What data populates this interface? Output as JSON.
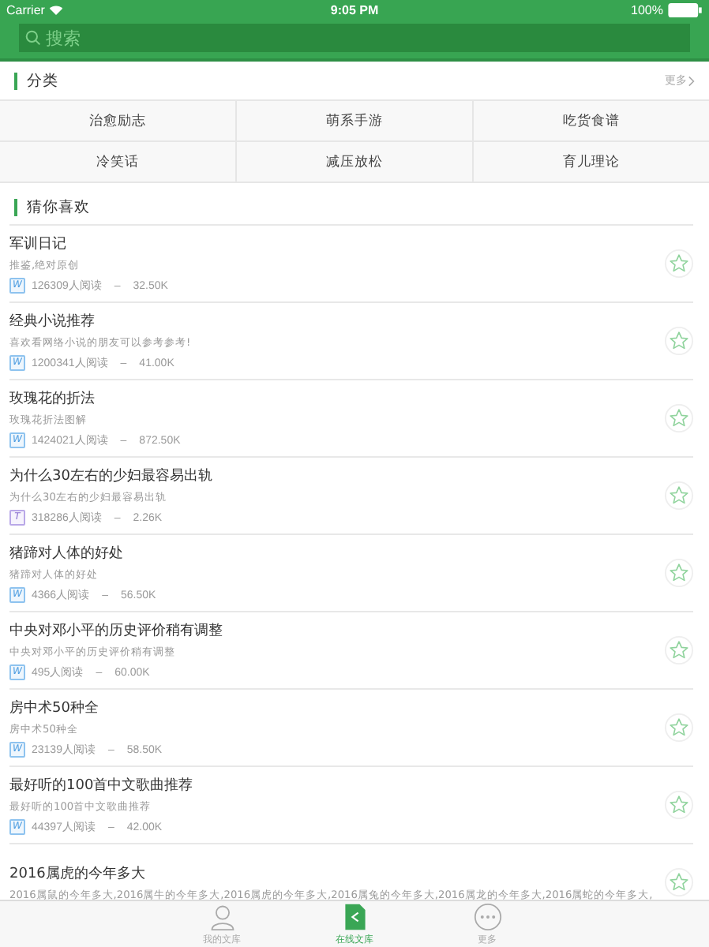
{
  "status_bar": {
    "carrier": "Carrier",
    "time": "9:05 PM",
    "battery": "100%"
  },
  "search": {
    "placeholder": "搜索"
  },
  "categories": {
    "title": "分类",
    "more": "更多",
    "items": [
      "治愈励志",
      "萌系手游",
      "吃货食谱",
      "冷笑话",
      "减压放松",
      "育儿理论"
    ]
  },
  "recommend": {
    "title": "猜你喜欢",
    "items": [
      {
        "title": "军训日记",
        "description": "推鉴,绝对原创",
        "kind": "word",
        "badge": "W",
        "readers": "126309人阅读",
        "separator": "–",
        "size": "32.50K",
        "favorite": false
      },
      {
        "title": "经典小说推荐",
        "description": "喜欢看网络小说的朋友可以参考参考!",
        "kind": "word",
        "badge": "W",
        "readers": "1200341人阅读",
        "separator": "–",
        "size": "41.00K",
        "favorite": false
      },
      {
        "title": "玫瑰花的折法",
        "description": "玫瑰花折法图解",
        "kind": "word",
        "badge": "W",
        "readers": "1424021人阅读",
        "separator": "–",
        "size": "872.50K",
        "favorite": false
      },
      {
        "title": "为什么30左右的少妇最容易出轨",
        "description": "为什么30左右的少妇最容易出轨",
        "kind": "txt",
        "badge": "T",
        "readers": "318286人阅读",
        "separator": "–",
        "size": "2.26K",
        "favorite": false
      },
      {
        "title": "猪蹄对人体的好处",
        "description": "猪蹄对人体的好处",
        "kind": "word",
        "badge": "W",
        "readers": "4366人阅读",
        "separator": "–",
        "size": "56.50K",
        "favorite": false
      },
      {
        "title": "中央对邓小平的历史评价稍有调整",
        "description": "中央对邓小平的历史评价稍有调整",
        "kind": "word",
        "badge": "W",
        "readers": "495人阅读",
        "separator": "–",
        "size": "60.00K",
        "favorite": false
      },
      {
        "title": "房中术50种全",
        "description": "房中术50种全",
        "kind": "word",
        "badge": "W",
        "readers": "23139人阅读",
        "separator": "–",
        "size": "58.50K",
        "favorite": false
      },
      {
        "title": "最好听的100首中文歌曲推荐",
        "description": "最好听的100首中文歌曲推荐",
        "kind": "word",
        "badge": "W",
        "readers": "44397人阅读",
        "separator": "–",
        "size": "42.00K",
        "favorite": false
      },
      {
        "title": "2016属虎的今年多大",
        "description": "2016属鼠的今年多大,2016属牛的今年多大,2016属虎的今年多大,2016属兔的今年多大,2016属龙的今年多大,2016属蛇的今年多大,",
        "favorite": false
      }
    ]
  },
  "tab_bar": [
    {
      "label": "我的文库",
      "kind": "person",
      "selected": false
    },
    {
      "label": "在线文库",
      "kind": "doc",
      "selected": true
    },
    {
      "label": "更多",
      "kind": "more",
      "selected": false
    }
  ]
}
